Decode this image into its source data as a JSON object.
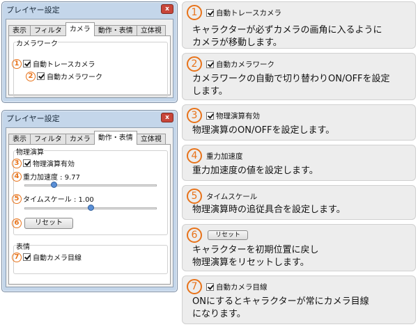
{
  "window1": {
    "title": "プレイヤー設定",
    "close": "x",
    "tabs": [
      "表示",
      "フィルタ",
      "カメラ",
      "動作・表情",
      "立体視"
    ],
    "group_label": "カメラワーク",
    "items": [
      {
        "num": "1",
        "label": "自動トレースカメラ"
      },
      {
        "num": "2",
        "label": "自動カメラワーク"
      }
    ]
  },
  "window2": {
    "title": "プレイヤー設定",
    "close": "x",
    "tabs": [
      "表示",
      "フィルタ",
      "カメラ",
      "動作・表情",
      "立体視"
    ],
    "physics_group_label": "物理演算",
    "physics_enabled": {
      "num": "3",
      "label": "物理演算有効"
    },
    "gravity": {
      "num": "4",
      "label": "重力加速度 : 9.77",
      "level": 0.22
    },
    "timescale": {
      "num": "5",
      "label": "タイムスケール : 1.00",
      "level": 0.5
    },
    "reset": {
      "num": "6",
      "label": "リセット"
    },
    "expression_group_label": "表情",
    "eye_contact": {
      "num": "7",
      "label": "自動カメラ目線"
    }
  },
  "callouts": [
    {
      "num": "1",
      "title": "自動トレースカメラ",
      "lines": [
        "キャラクターが必ずカメラの画角に入るように",
        "カメラが移動します。"
      ]
    },
    {
      "num": "2",
      "title": "自動カメラワーク",
      "lines": [
        "カメラワークの自動で切り替わりON/OFFを設定",
        "します。"
      ]
    },
    {
      "num": "3",
      "title": "物理演算有効",
      "lines": [
        "物理演算のON/OFFを設定します。"
      ]
    },
    {
      "num": "4",
      "title": "重力加速度",
      "lines": [
        "重力加速度の値を設定します。"
      ]
    },
    {
      "num": "5",
      "title": "タイムスケール",
      "lines": [
        "物理演算時の追従具合を設定します。"
      ]
    },
    {
      "num": "6",
      "title": "リセット",
      "lines": [
        "キャラクターを初期位置に戻し",
        "物理演算をリセットします。"
      ]
    },
    {
      "num": "7",
      "title": "自動カメラ目線",
      "lines": [
        "ONにするとキャラクターが常にカメラ目線",
        "になります。"
      ]
    }
  ]
}
